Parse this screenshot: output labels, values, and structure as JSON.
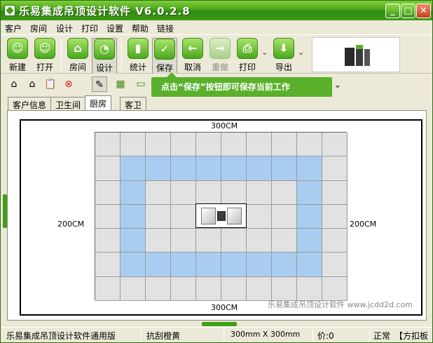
{
  "window": {
    "title": "乐易集成吊顶设计软件 V6.0.2.8"
  },
  "menu": [
    "客户",
    "房间",
    "设计",
    "打印",
    "设置",
    "帮助",
    "链接"
  ],
  "toolbar": {
    "new": "新建",
    "open": "打开",
    "room": "房间",
    "design": "设计",
    "stats": "统计",
    "save": "保存",
    "cancel": "取消",
    "redo": "重做",
    "print": "打印",
    "export": "导出"
  },
  "hint": "点击“保存”按钮即可保存当前工作",
  "tabs": [
    "客户信息",
    "卫生间",
    "厨房",
    "客卫"
  ],
  "active_tab": "厨房",
  "canvas": {
    "top_dim": "300CM",
    "bottom_dim": "300CM",
    "left_dim": "200CM",
    "right_dim": "200CM",
    "watermark": "乐易集成吊顶设计软件 www.jcdd2d.com",
    "grid_cols": 10,
    "grid_rows": 7
  },
  "status": {
    "edition": "乐易集成吊顶设计软件通用版",
    "material": "抗刮橙黄",
    "tile_size": "300mm X 300mm",
    "price": "价:0",
    "mode": "正常",
    "tile_type": "【方扣板"
  },
  "colors": {
    "accent": "#4aa81c",
    "panel_blue": "#a9cdf0",
    "panel_gray": "#e0e0e0"
  }
}
